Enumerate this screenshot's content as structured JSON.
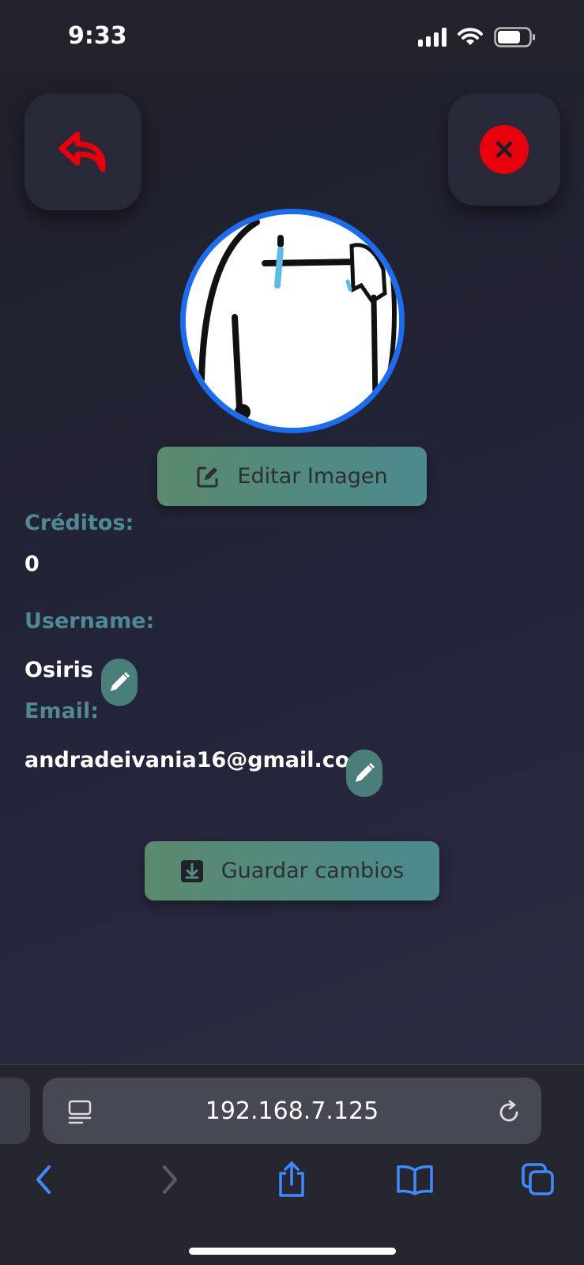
{
  "status_bar": {
    "time": "9:33"
  },
  "profile": {
    "edit_image_label": "Editar Imagen",
    "credits_label": "Créditos:",
    "credits_value": "0",
    "username_label": "Username:",
    "username_value": "Osiris",
    "email_label": "Email:",
    "email_value": "andradeivania16@gmail.com",
    "save_label": "Guardar cambios"
  },
  "browser": {
    "url": "192.168.7.125"
  },
  "colors": {
    "accent_label": "#4f8a93",
    "button_gradient_start": "#5a8a6e",
    "button_gradient_end": "#4c8a8f",
    "back_icon": "#e8000b",
    "avatar_border": "#1a6cf0",
    "browser_link": "#3d8bff"
  },
  "icons": {
    "back": "reply-arrow-icon",
    "close": "close-icon",
    "edit_image": "edit-square-icon",
    "edit_field": "pencil-icon",
    "save": "download-box-icon",
    "reader": "reader-mode-icon",
    "reload": "reload-icon"
  }
}
